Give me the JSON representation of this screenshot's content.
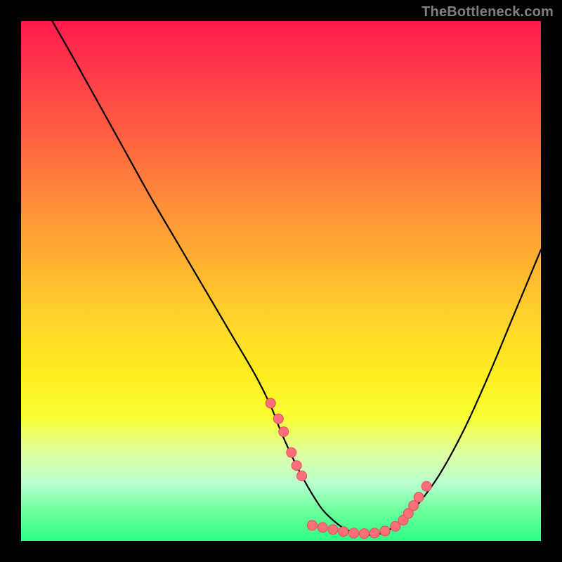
{
  "watermark": "TheBottleneck.com",
  "chart_data": {
    "type": "line",
    "title": "",
    "xlabel": "",
    "ylabel": "",
    "xlim": [
      0,
      100
    ],
    "ylim": [
      0,
      100
    ],
    "curve": {
      "x": [
        6,
        10,
        15,
        20,
        25,
        30,
        35,
        40,
        45,
        48,
        50,
        52,
        54,
        56,
        58,
        60,
        62,
        64,
        66,
        68,
        70,
        72,
        75,
        80,
        85,
        90,
        95,
        100
      ],
      "y": [
        100,
        93,
        84,
        75,
        66,
        57.5,
        49,
        40.5,
        32,
        26,
        21,
        16.5,
        12.5,
        9,
        6,
        4,
        2.5,
        1.6,
        1.2,
        1.2,
        1.7,
        3,
        5.5,
        12,
        21,
        32,
        44,
        56
      ]
    },
    "dots": {
      "x": [
        48,
        50,
        52,
        54,
        56,
        58,
        60,
        62,
        64,
        66,
        68,
        70,
        72,
        74,
        75
      ],
      "y": [
        26,
        21,
        16.5,
        12.5,
        9,
        6,
        4,
        2.5,
        1.6,
        1.2,
        1.2,
        1.7,
        3,
        5,
        5.5
      ]
    },
    "dot_left_cluster": {
      "x": [
        48,
        49.5,
        50.5,
        52,
        53,
        54
      ],
      "y": [
        26.5,
        23.5,
        21,
        17,
        14.5,
        12.5
      ]
    },
    "dot_right_cluster": {
      "x": [
        73.5,
        74.5,
        75.5,
        76.5,
        78
      ],
      "y": [
        4,
        5.3,
        6.8,
        8.4,
        10.5
      ]
    },
    "dot_bottom_cluster": {
      "x": [
        56,
        58,
        60,
        62,
        64,
        66,
        68,
        70,
        72
      ],
      "y": [
        3.0,
        2.6,
        2.2,
        1.8,
        1.5,
        1.4,
        1.5,
        1.9,
        2.8
      ]
    },
    "colors": {
      "curve": "#000000",
      "dot_fill": "#ff6f7a",
      "dot_stroke": "#e04e5a"
    }
  }
}
